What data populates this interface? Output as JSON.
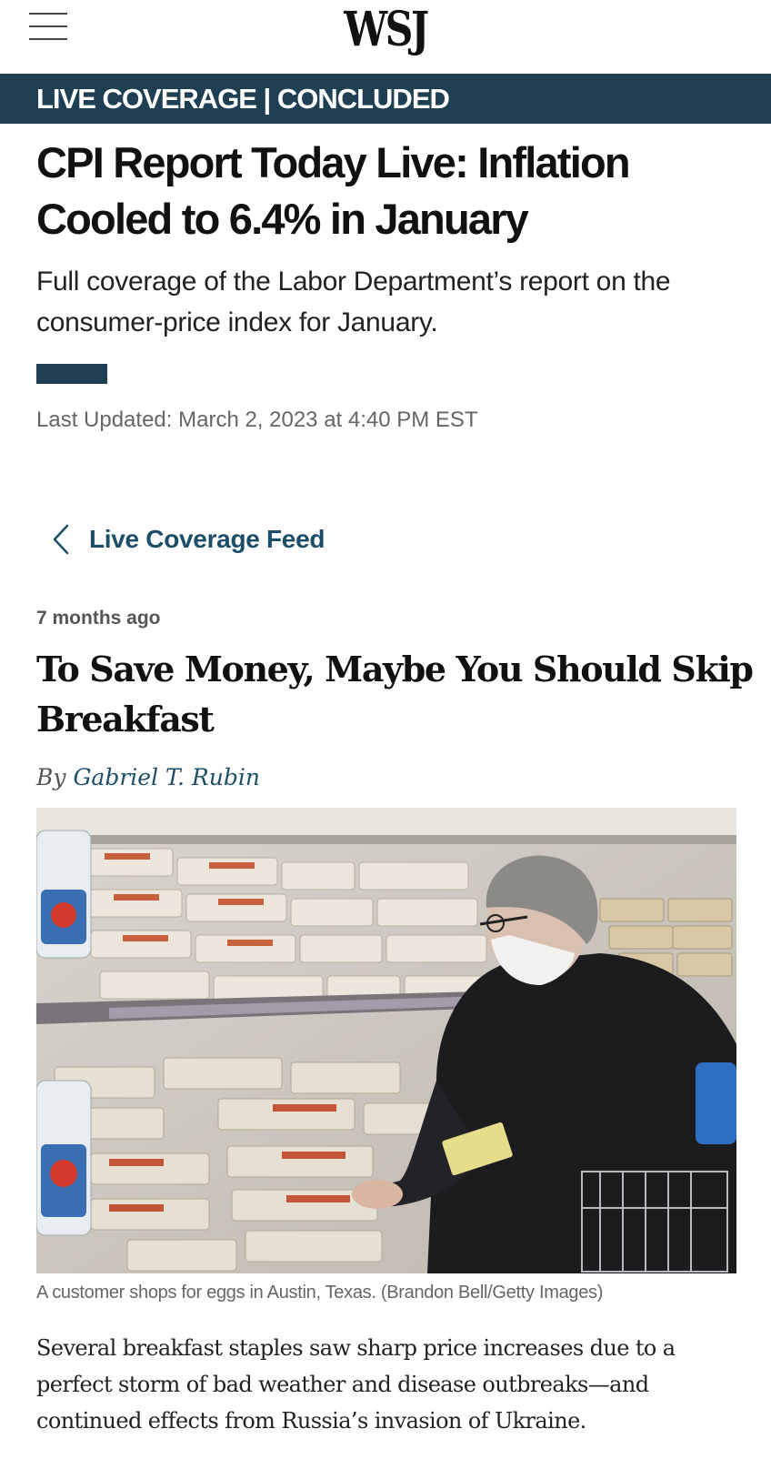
{
  "header": {
    "logo": "WSJ",
    "menu_icon": "hamburger-menu-icon"
  },
  "banner": {
    "label": "LIVE COVERAGE | CONCLUDED",
    "color": "#1f3f52"
  },
  "article": {
    "headline": "CPI Report Today Live: Inflation Cooled to 6.4% in January",
    "dek": "Full coverage of the Labor Department’s report on the consumer-price index for January.",
    "last_updated": "Last Updated: March 2, 2023 at 4:40 PM EST"
  },
  "feed_link": {
    "label": "Live Coverage Feed",
    "icon": "chevron-left-icon",
    "color": "#1c4e68"
  },
  "post": {
    "time_ago": "7 months ago",
    "title": "To Save Money, Maybe You Should Skip Breakfast",
    "byline_prefix": "By",
    "author": "Gabriel T. Rubin",
    "image": {
      "subject": "customer-shopping-for-eggs-photo"
    },
    "caption": "A customer shops for eggs in Austin, Texas. (Brandon Bell/Getty Images)",
    "body": "Several breakfast staples saw sharp price increases due to a perfect storm of bad weather and disease outbreaks—and continued effects from Russia’s invasion of Ukraine."
  }
}
